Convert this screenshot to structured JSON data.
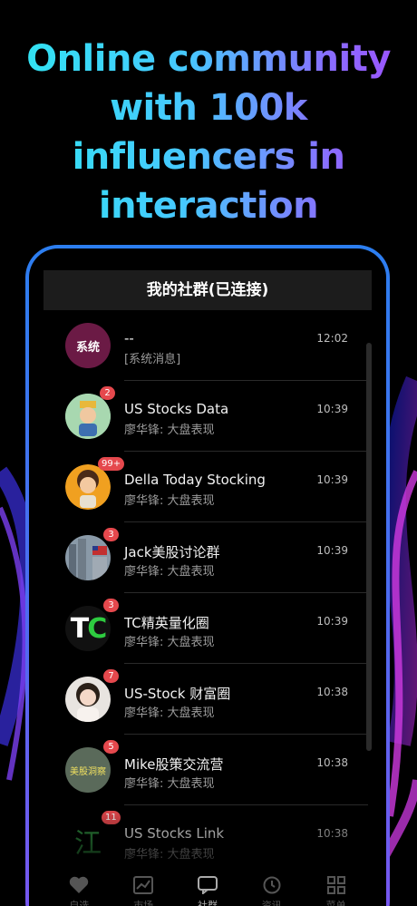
{
  "headline": [
    "Online community",
    "with 100k",
    "influencers in",
    "interaction"
  ],
  "screen_title": "我的社群(已连接)",
  "chats": [
    {
      "avatar": "system",
      "avatar_text": "系统",
      "badge": "",
      "name": "--",
      "message": "[系统消息]",
      "time": "12:02"
    },
    {
      "avatar": "cartoon-knight",
      "badge": "2",
      "name": "US Stocks Data",
      "message": "廖华锋: 大盘表现",
      "time": "10:39"
    },
    {
      "avatar": "cartoon-girl",
      "badge": "99+",
      "name": "Della Today Stocking",
      "message": "廖华锋: 大盘表现",
      "time": "10:39"
    },
    {
      "avatar": "city-flag",
      "badge": "3",
      "name": "Jack美股讨论群",
      "message": "廖华锋: 大盘表现",
      "time": "10:39"
    },
    {
      "avatar": "tc-logo",
      "avatar_text": "TC",
      "badge": "3",
      "name": "TC精英量化圈",
      "message": "廖华锋: 大盘表现",
      "time": "10:39"
    },
    {
      "avatar": "woman-photo",
      "badge": "7",
      "name": "US-Stock 财富圈",
      "message": "廖华锋: 大盘表现",
      "time": "10:38"
    },
    {
      "avatar": "stock-insight-logo",
      "avatar_text": "美股洞察",
      "badge": "5",
      "name": "Mike股策交流营",
      "message": "廖华锋: 大盘表现",
      "time": "10:38"
    },
    {
      "avatar": "chinese-char-logo",
      "avatar_text": "江",
      "badge": "11",
      "name": "US Stocks Link",
      "message": "廖华锋: 大盘表现",
      "time": "10:38"
    }
  ],
  "tabs": [
    {
      "label": "自选",
      "icon": "heart-icon"
    },
    {
      "label": "市场",
      "icon": "chart-icon"
    },
    {
      "label": "社群",
      "icon": "chat-icon"
    },
    {
      "label": "资讯",
      "icon": "clock-icon"
    },
    {
      "label": "菜单",
      "icon": "grid-icon"
    }
  ],
  "colors": {
    "accent_gradient_start": "#2fe6f0",
    "accent_gradient_end": "#a04dff",
    "badge": "#e5484d",
    "system_avatar": "#6b1a45",
    "frame": "#4c6cf0"
  }
}
